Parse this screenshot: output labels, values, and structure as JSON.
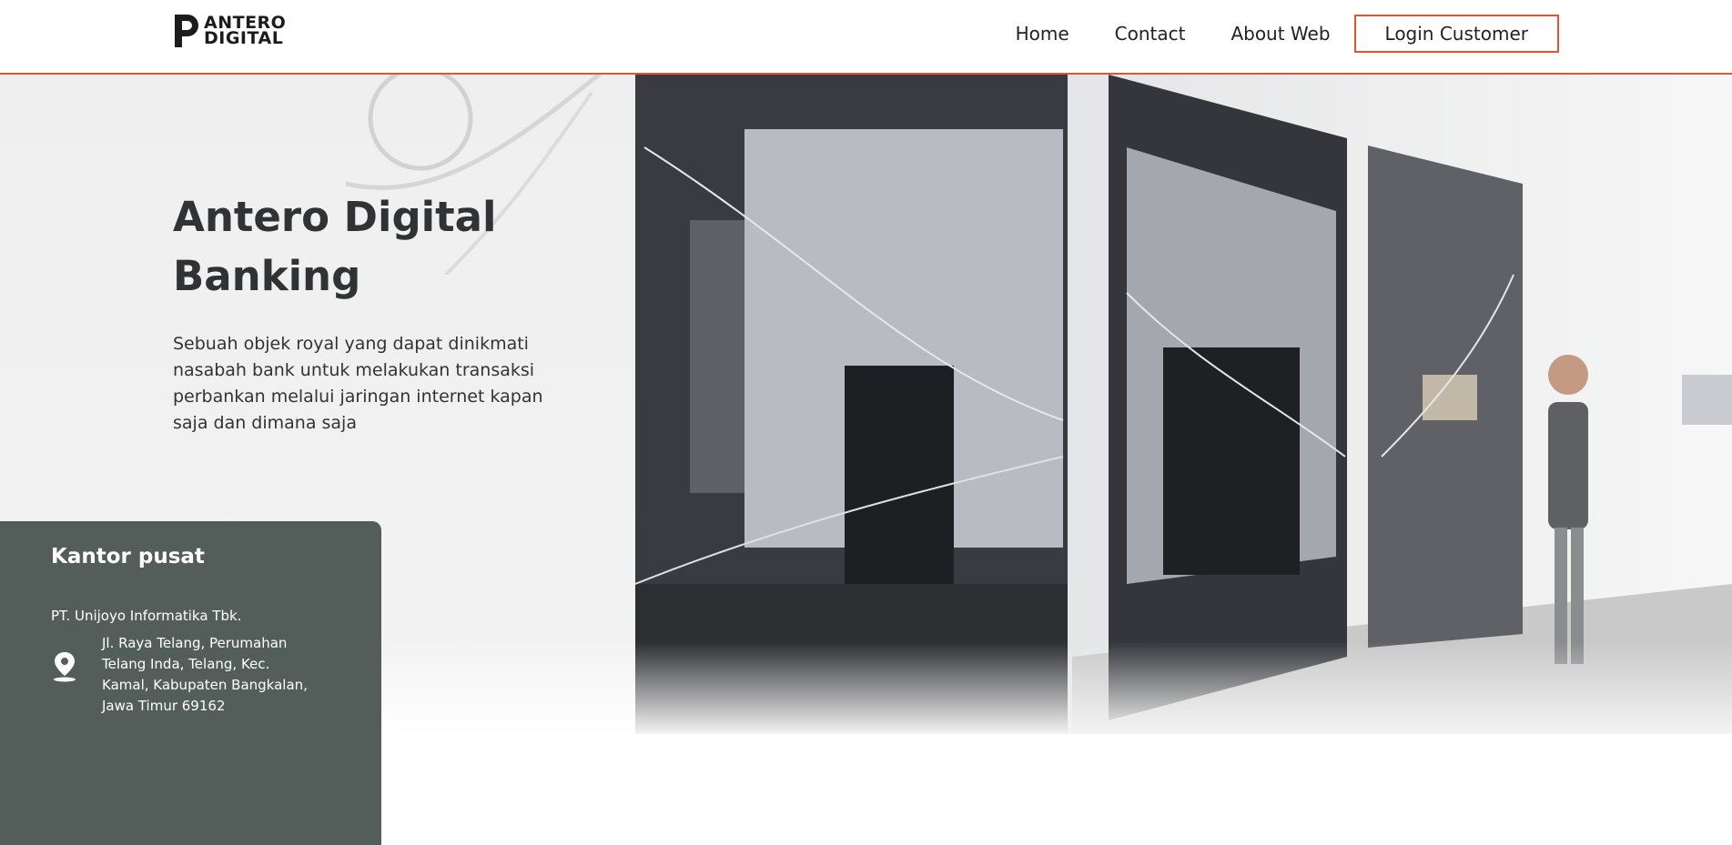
{
  "brand": {
    "line1": "ANTERO",
    "line2": "DIGITAL"
  },
  "nav": {
    "home": "Home",
    "contact": "Contact",
    "about": "About Web",
    "login": "Login Customer"
  },
  "hero": {
    "title": "Antero Digital Banking",
    "description": "Sebuah objek royal yang dapat dinikmati nasabah bank untuk melakukan transaksi perbankan melalui jaringan internet kapan saja dan dimana saja"
  },
  "office": {
    "title": "Kantor pusat",
    "company": "PT. Unijoyo Informatika Tbk.",
    "address": "Jl. Raya Telang, Perumahan Telang Inda, Telang, Kec. Kamal, Kabupaten Bangkalan, Jawa Timur 69162",
    "icon": "location-pin-icon"
  },
  "colors": {
    "accent": "#e8542a",
    "card": "#535e5b",
    "heading": "#2f3333"
  }
}
